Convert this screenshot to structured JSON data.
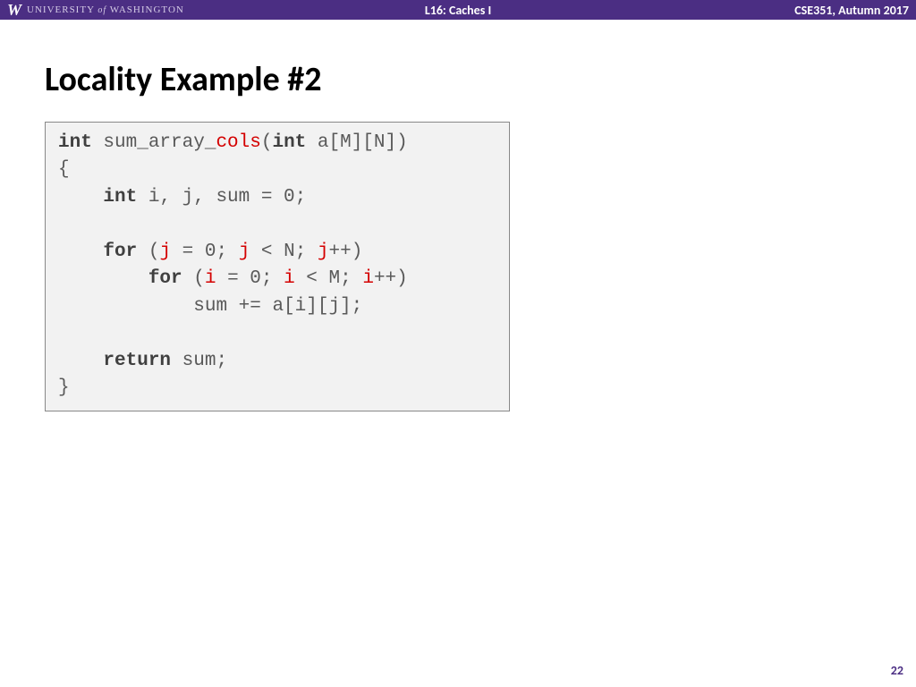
{
  "header": {
    "logo_letter": "W",
    "university_pre": "UNIVERSITY",
    "university_of": "of",
    "university_post": "WASHINGTON",
    "lecture": "L16:  Caches I",
    "course": "CSE351, Autumn 2017"
  },
  "title": "Locality Example #2",
  "code": {
    "l1_kw1": "int",
    "l1_t1": " sum_array_",
    "l1_hl": "cols",
    "l1_t2": "(",
    "l1_kw2": "int",
    "l1_t3": " a[M][N])",
    "l2": "{",
    "l3_kw": "int",
    "l3_t": " i, j, sum = 0;",
    "l5_kw": "for",
    "l5_t1": " (",
    "l5_hl1": "j",
    "l5_t2": " = 0; ",
    "l5_hl2": "j",
    "l5_t3": " < N; ",
    "l5_hl3": "j",
    "l5_t4": "++)",
    "l6_kw": "for",
    "l6_t1": " (",
    "l6_hl1": "i",
    "l6_t2": " = 0; ",
    "l6_hl2": "i",
    "l6_t3": " < M; ",
    "l6_hl3": "i",
    "l6_t4": "++)",
    "l7": "sum += a[i][j];",
    "l9_kw": "return",
    "l9_t": " sum;",
    "l10": "}"
  },
  "page_number": "22"
}
